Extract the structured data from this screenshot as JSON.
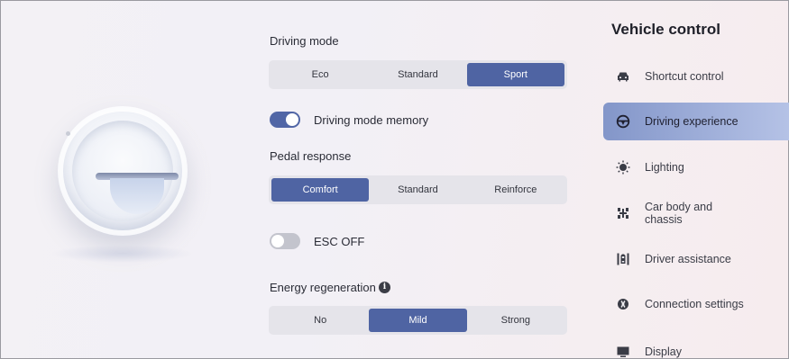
{
  "settings": {
    "driving_mode": {
      "label": "Driving mode",
      "options": [
        "Eco",
        "Standard",
        "Sport"
      ],
      "selected": "Sport"
    },
    "driving_mode_memory": {
      "label": "Driving mode memory",
      "enabled": true
    },
    "pedal_response": {
      "label": "Pedal response",
      "options": [
        "Comfort",
        "Standard",
        "Reinforce"
      ],
      "selected": "Comfort"
    },
    "esc_off": {
      "label": "ESC OFF",
      "enabled": false
    },
    "energy_regeneration": {
      "label": "Energy regeneration",
      "info_icon": "i",
      "options": [
        "No",
        "Mild",
        "Strong"
      ],
      "selected": "Mild"
    }
  },
  "nav": {
    "title": "Vehicle control",
    "items": [
      {
        "label": "Shortcut control",
        "icon": "car-icon"
      },
      {
        "label": "Driving experience",
        "icon": "steering-wheel-icon",
        "active": true
      },
      {
        "label": "Lighting",
        "icon": "light-icon"
      },
      {
        "label": "Car body and chassis",
        "icon": "chassis-icon"
      },
      {
        "label": "Driver assistance",
        "icon": "driver-assist-icon"
      },
      {
        "label": "Connection settings",
        "icon": "connection-icon"
      },
      {
        "label": "Display",
        "icon": "display-icon"
      }
    ]
  },
  "colors": {
    "accent": "#4f64a3",
    "active_nav": "#8396c9",
    "segment_bg": "#e5e4ea"
  }
}
